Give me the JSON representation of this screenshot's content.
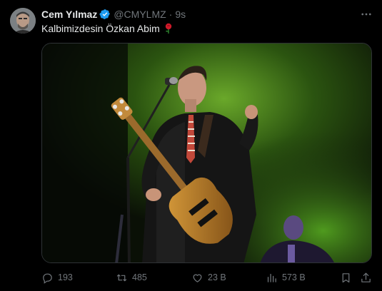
{
  "tweet": {
    "author_name": "Cem Yılmaz",
    "handle": "@CMYLMZ",
    "separator": "·",
    "time": "9s",
    "text": "Kalbimizdesin Özkan Abim",
    "icons": {
      "verified": "verified-badge-icon",
      "more": "more-options-icon",
      "emoji": "rose-icon"
    },
    "accent_color": "#1d9bf0",
    "media": {
      "kind": "photo",
      "description_color_stage": "#3f7a1a"
    }
  },
  "actions": {
    "reply_count": "193",
    "retweet_count": "485",
    "like_count": "23 B",
    "views_count": "573 B",
    "icons": [
      "reply-icon",
      "retweet-icon",
      "like-icon",
      "views-icon",
      "bookmark-icon",
      "share-icon"
    ]
  }
}
